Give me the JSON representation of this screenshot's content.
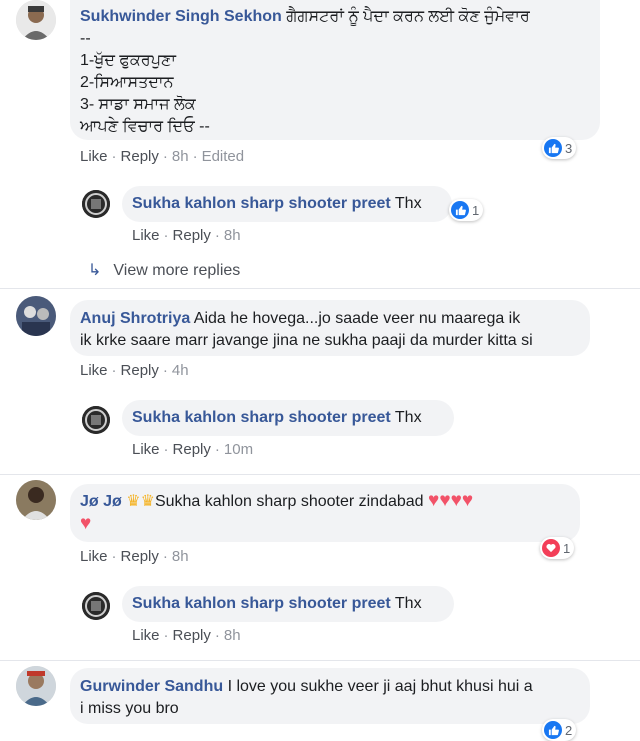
{
  "comments": [
    {
      "name": "Sukhwinder Singh Sekhon",
      "lines": [
        "ਗੈਗਸਟਰਾਂ ਨੂੰ ਪੈਦਾ ਕਰਨ ਲਈ ਕੋਣ ਜੁੰਮੇਵਾਰ",
        "--",
        "1-ਖੁੱਦ ਫੁਕਰਪੁਣਾ",
        "2-ਸਿਆਸਤਦਾਨ",
        "3- ਸਾਡਾ ਸਮਾਜ ਲੋਕ",
        "ਆਪਣੇ ਵਿਚਾਰ ਦਿਓ --"
      ],
      "like": "Like",
      "reply": "Reply",
      "time": "8h",
      "edited": "Edited",
      "reaction_count": "3"
    },
    {
      "name": "Sukha kahlon sharp shooter preet",
      "text": "Thx",
      "like": "Like",
      "reply": "Reply",
      "time": "8h",
      "reaction_count": "1"
    },
    {
      "name": "Anuj Shrotriya",
      "lines": [
        "Aida he hovega...jo saade veer nu maarega ik",
        "ik krke saare marr javange jina ne sukha paaji da murder kitta si"
      ],
      "like": "Like",
      "reply": "Reply",
      "time": "4h"
    },
    {
      "name": "Sukha kahlon sharp shooter preet",
      "text": "Thx",
      "like": "Like",
      "reply": "Reply",
      "time": "10m"
    },
    {
      "name": "Jø Jø",
      "text": "Sukha kahlon sharp shooter zindabad",
      "like": "Like",
      "reply": "Reply",
      "time": "8h",
      "reaction_count": "1"
    },
    {
      "name": "Sukha kahlon sharp shooter preet",
      "text": "Thx",
      "like": "Like",
      "reply": "Reply",
      "time": "8h"
    },
    {
      "name": "Gurwinder Sandhu",
      "lines": [
        "I love you sukhe veer ji aaj bhut khusi hui a",
        "i miss you bro"
      ],
      "reaction_count": "2"
    }
  ],
  "view_more_replies": "View more replies",
  "colors": {
    "name": "#385898",
    "bubble": "#f2f3f5",
    "like_blue": "#1877f2",
    "love_red": "#f33e58"
  }
}
